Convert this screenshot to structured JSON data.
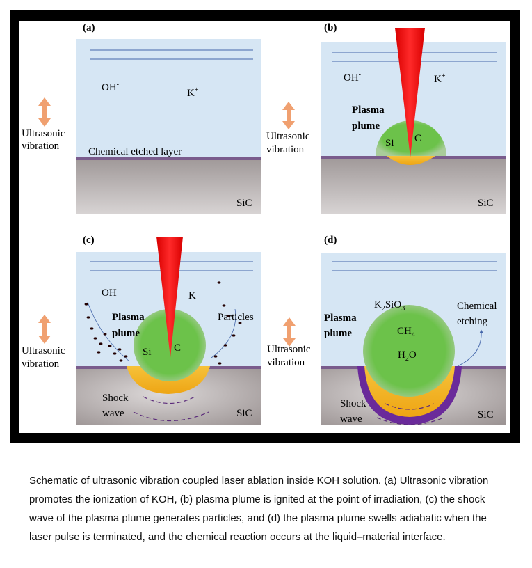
{
  "colors": {
    "frame": "#000000",
    "panel_bg": "#ffffff",
    "liquid": "#d6e6f4",
    "substrate_top": "#a49c9c",
    "substrate_bottom": "#d4d0d0",
    "etched_layer": "#7a5c8c",
    "laser": "#ee1111",
    "plume": "#6cc24a",
    "molten": "#f2b21a",
    "arrow": "#f0a070",
    "flow_line": "#4466aa",
    "shock": "#5a2a7a",
    "particle": "#220000",
    "etch_ring": "#6a2a9a"
  },
  "panels": {
    "a": {
      "tag": "(a)",
      "oh": "OH",
      "oh_sup": "-",
      "k": "K",
      "k_sup": "+",
      "vib1": "Ultrasonic",
      "vib2": "vibration",
      "layer": "Chemical etched layer",
      "sic": "SiC"
    },
    "b": {
      "tag": "(b)",
      "oh": "OH",
      "oh_sup": "-",
      "k": "K",
      "k_sup": "+",
      "plasma1": "Plasma",
      "plasma2": "plume",
      "si": "Si",
      "c": "C",
      "vib1": "Ultrasonic",
      "vib2": "vibration",
      "sic": "SiC"
    },
    "c": {
      "tag": "(c)",
      "oh": "OH",
      "oh_sup": "-",
      "k": "K",
      "k_sup": "+",
      "plasma1": "Plasma",
      "plasma2": "plume",
      "si": "Si",
      "c": "C",
      "particles": "Particles",
      "vib1": "Ultrasonic",
      "vib2": "vibration",
      "shock1": "Shock",
      "shock2": "wave",
      "sic": "SiC"
    },
    "d": {
      "tag": "(d)",
      "k2sio3_a": "K",
      "k2sio3_sub": "2",
      "k2sio3_b": "SiO",
      "k2sio3_sub2": "3",
      "ch4_a": "CH",
      "ch4_sub": "4",
      "h2o_a": "H",
      "h2o_sub": "2",
      "h2o_b": "O",
      "plasma1": "Plasma",
      "plasma2": "plume",
      "chem1": "Chemical",
      "chem2": "etching",
      "vib1": "Ultrasonic",
      "vib2": "vibration",
      "shock1": "Shock",
      "shock2": "wave",
      "sic": "SiC"
    }
  },
  "caption": "Schematic of ultrasonic vibration coupled laser ablation inside KOH solution. (a) Ultrasonic vibration promotes the ionization of KOH, (b) plasma plume is ignited at the point of irradiation, (c) the shock wave of the plasma plume generates particles, and (d) the plasma plume swells adiabatic when the laser pulse is terminated, and the chemical reaction occurs at the liquid–material interface."
}
